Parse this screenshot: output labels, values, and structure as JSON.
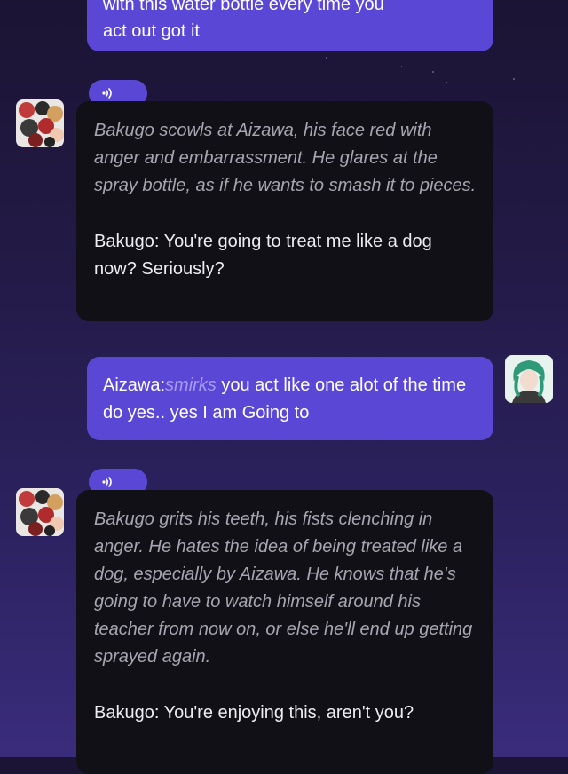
{
  "messages": {
    "user_top_line1": "with this water bottle every time you",
    "user_top_line2": "act out got it",
    "bot1_narration": "Bakugo scowls at Aizawa, his face red with anger and embarrassment. He glares at the spray bottle, as if he wants to smash it to pieces.",
    "bot1_speech": "Bakugo: You're going to treat me like a dog now? Seriously?",
    "user2_prefix": "Aizawa:",
    "user2_emphasis": "smirks",
    "user2_rest": " you act like one alot of the time do yes.. yes I am Going to",
    "bot2_narration": "Bakugo grits his teeth, his fists clenching in anger. He hates the idea of being treated like a dog, especially by Aizawa. He knows that he's going to have to watch himself around his teacher from now on, or else he'll end up getting sprayed again.",
    "bot2_speech": "Bakugo: You're enjoying this, aren't you?"
  },
  "icons": {
    "audio": "speaker-wave-icon",
    "bot_avatar": "character-avatar",
    "user_avatar": "user-avatar"
  },
  "colors": {
    "user_bubble": "#5a47d6",
    "bot_bubble": "#111016",
    "narration": "#a7a6b0",
    "emphasis": "#a89af0"
  }
}
